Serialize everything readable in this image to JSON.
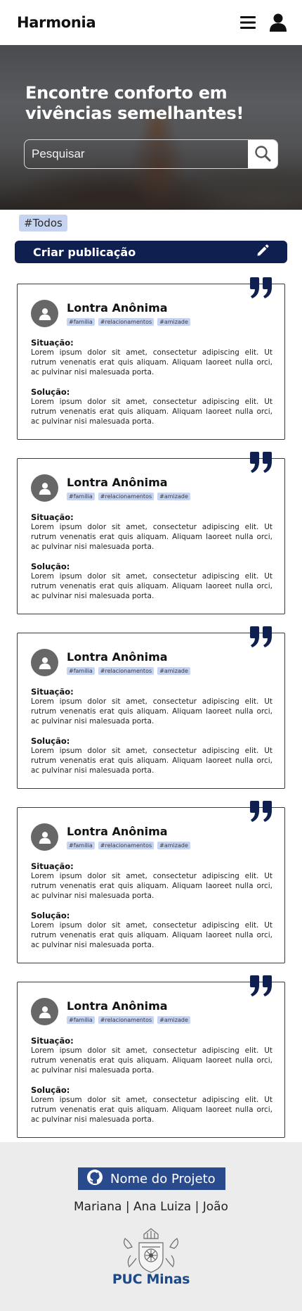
{
  "app": {
    "brand": "Harmonia"
  },
  "header": {
    "menu_icon": "hamburger-menu-icon",
    "user_icon": "user-icon"
  },
  "hero": {
    "title": "Encontre conforto em vivências semelhantes!",
    "search_placeholder": "Pesquisar",
    "search_icon": "search-icon"
  },
  "filter": {
    "active_tag": "#Todos"
  },
  "create_post": {
    "label": "Criar publicação",
    "icon": "pencil-icon"
  },
  "posts": [
    {
      "author": "Lontra Anônima",
      "tags": [
        "#familia",
        "#relacionamentos",
        "#amizade"
      ],
      "situation_label": "Situação:",
      "situation_text": "Lorem ipsum dolor sit amet, consectetur adipiscing elit. Ut rutrum venenatis erat quis aliquam. Aliquam laoreet nulla orci, ac pulvinar nisi malesuada porta.",
      "solution_label": "Solução:",
      "solution_text": "Lorem ipsum dolor sit amet, consectetur adipiscing elit. Ut rutrum venenatis erat quis aliquam. Aliquam laoreet nulla orci, ac pulvinar nisi malesuada porta."
    },
    {
      "author": "Lontra Anônima",
      "tags": [
        "#familia",
        "#relacionamentos",
        "#amizade"
      ],
      "situation_label": "Situação:",
      "situation_text": "Lorem ipsum dolor sit amet, consectetur adipiscing elit. Ut rutrum venenatis erat quis aliquam. Aliquam laoreet nulla orci, ac pulvinar nisi malesuada porta.",
      "solution_label": "Solução:",
      "solution_text": "Lorem ipsum dolor sit amet, consectetur adipiscing elit. Ut rutrum venenatis erat quis aliquam. Aliquam laoreet nulla orci, ac pulvinar nisi malesuada porta."
    },
    {
      "author": "Lontra Anônima",
      "tags": [
        "#familia",
        "#relacionamentos",
        "#amizade"
      ],
      "situation_label": "Situação:",
      "situation_text": "Lorem ipsum dolor sit amet, consectetur adipiscing elit. Ut rutrum venenatis erat quis aliquam. Aliquam laoreet nulla orci, ac pulvinar nisi malesuada porta.",
      "solution_label": "Solução:",
      "solution_text": "Lorem ipsum dolor sit amet, consectetur adipiscing elit. Ut rutrum venenatis erat quis aliquam. Aliquam laoreet nulla orci, ac pulvinar nisi malesuada porta."
    },
    {
      "author": "Lontra Anônima",
      "tags": [
        "#familia",
        "#relacionamentos",
        "#amizade"
      ],
      "situation_label": "Situação:",
      "situation_text": "Lorem ipsum dolor sit amet, consectetur adipiscing elit. Ut rutrum venenatis erat quis aliquam. Aliquam laoreet nulla orci, ac pulvinar nisi malesuada porta.",
      "solution_label": "Solução:",
      "solution_text": "Lorem ipsum dolor sit amet, consectetur adipiscing elit. Ut rutrum venenatis erat quis aliquam. Aliquam laoreet nulla orci, ac pulvinar nisi malesuada porta."
    },
    {
      "author": "Lontra Anônima",
      "tags": [
        "#familia",
        "#relacionamentos",
        "#amizade"
      ],
      "situation_label": "Situação:",
      "situation_text": "Lorem ipsum dolor sit amet, consectetur adipiscing elit. Ut rutrum venenatis erat quis aliquam. Aliquam laoreet nulla orci, ac pulvinar nisi malesuada porta.",
      "solution_label": "Solução:",
      "solution_text": "Lorem ipsum dolor sit amet, consectetur adipiscing elit. Ut rutrum venenatis erat quis aliquam. Aliquam laoreet nulla orci, ac pulvinar nisi malesuada porta."
    }
  ],
  "footer": {
    "repo_label": "Nome do Projeto",
    "repo_icon": "github-icon",
    "authors": "Mariana | Ana Luiza | João",
    "logo_text": "PUC Minas"
  },
  "colors": {
    "navy": "#0f1f4f",
    "tag_bg": "#c6d3f1",
    "footer_bg": "#ececec",
    "repo_badge": "#294b8e",
    "puc_blue": "#1d4a86"
  }
}
